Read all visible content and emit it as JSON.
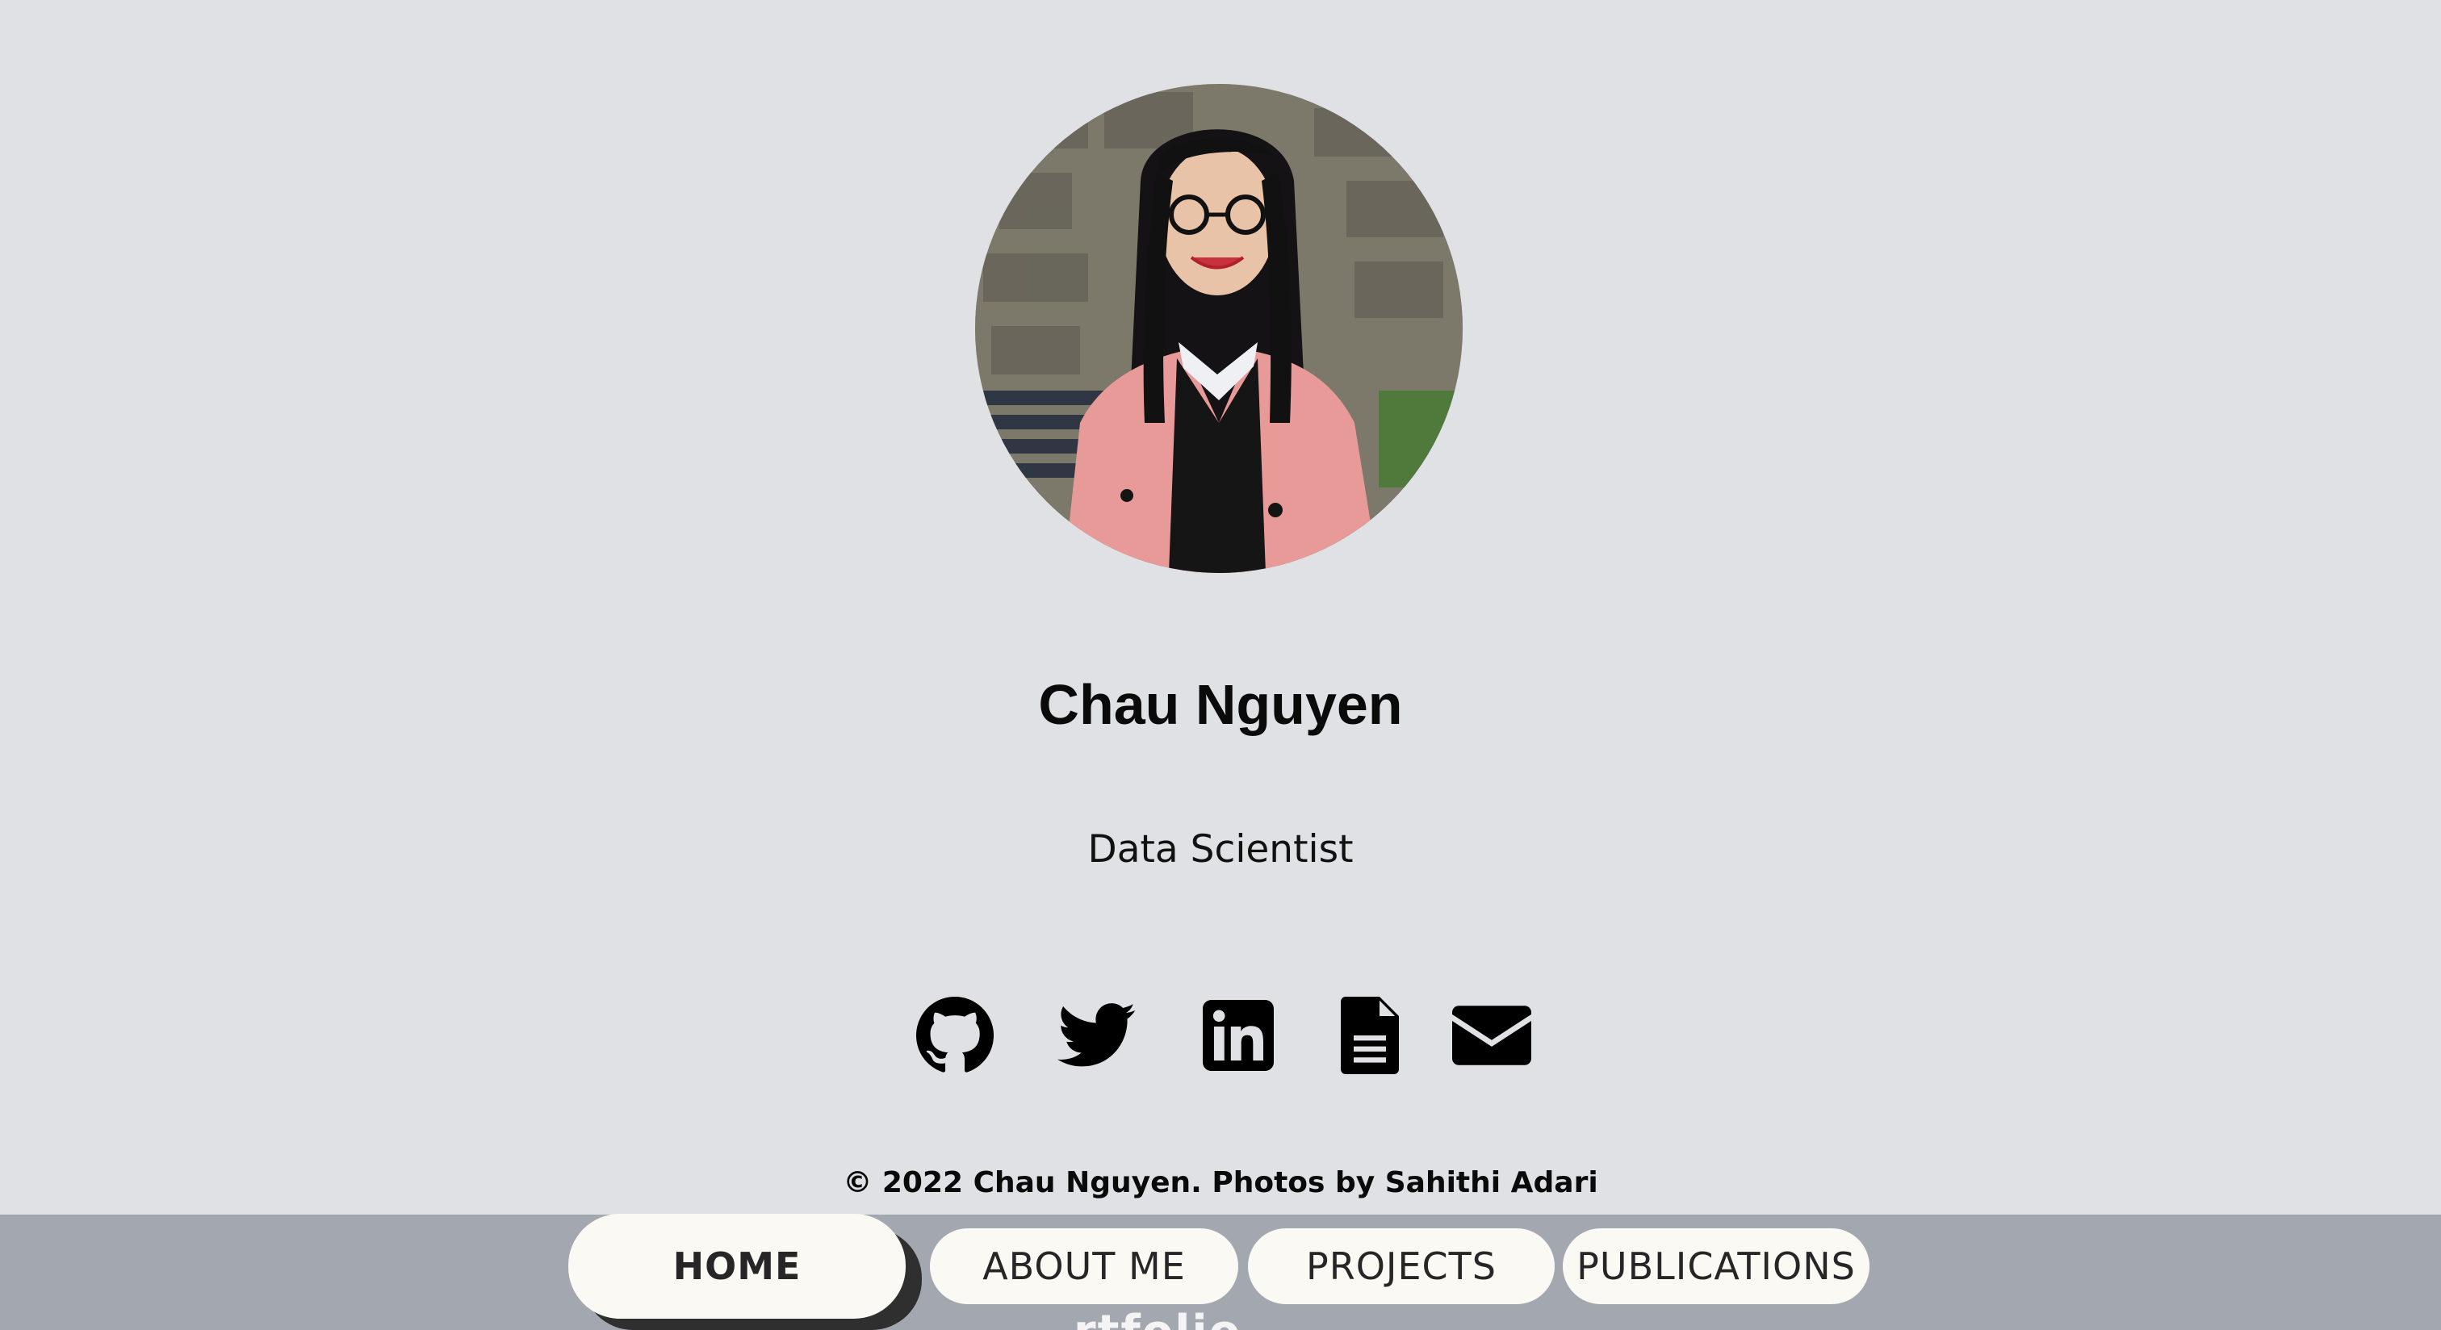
{
  "profile": {
    "name": "Chau Nguyen",
    "role": "Data Scientist"
  },
  "social": [
    {
      "icon": "github-icon"
    },
    {
      "icon": "twitter-icon"
    },
    {
      "icon": "linkedin-icon"
    },
    {
      "icon": "file-icon"
    },
    {
      "icon": "mail-icon"
    }
  ],
  "footer": {
    "copyright": "© 2022 Chau Nguyen. Photos by Sahithi Adari"
  },
  "nav": {
    "home": "HOME",
    "about": "ABOUT ME",
    "projects": "PROJECTS",
    "publications": "PUBLICATIONS",
    "active": "HOME"
  },
  "colors": {
    "page_bg": "#dfe1e5",
    "navbar_bg": "#a3a8b0",
    "button_bg": "#fbf9f3",
    "text": "#0a0a0a"
  }
}
